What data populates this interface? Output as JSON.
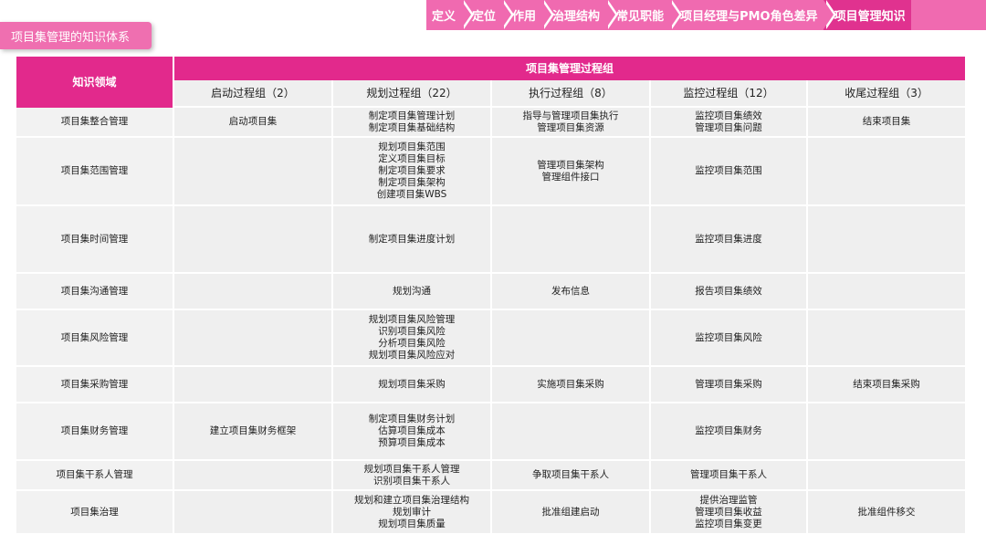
{
  "nav": {
    "items": [
      "定义",
      "定位",
      "作用",
      "治理结构",
      "常见职能",
      "项目经理与PMO角色差异",
      "项目管理知识"
    ],
    "active_index": 6
  },
  "page_title": "项目集管理的知识体系",
  "table": {
    "domain_header": "知识领域",
    "group_header": "项目集管理过程组",
    "columns": [
      "启动过程组（2）",
      "规划过程组（22）",
      "执行过程组（8）",
      "监控过程组（12）",
      "收尾过程组（3）"
    ],
    "rows": [
      {
        "domain": "项目集整合管理",
        "cells": [
          [
            "启动项目集"
          ],
          [
            "制定项目集管理计划",
            "制定项目集基础结构"
          ],
          [
            "指导与管理项目集执行",
            "管理项目集资源"
          ],
          [
            "监控项目集绩效",
            "管理项目集问题"
          ],
          [
            "结束项目集"
          ]
        ]
      },
      {
        "domain": "项目集范围管理",
        "cells": [
          [],
          [
            "规划项目集范围",
            "定义项目集目标",
            "制定项目集要求",
            "制定项目集架构",
            "创建项目集WBS"
          ],
          [
            "管理项目集架构",
            "管理组件接口"
          ],
          [
            "监控项目集范围"
          ],
          []
        ]
      },
      {
        "domain": "项目集时间管理",
        "cells": [
          [],
          [
            "制定项目集进度计划"
          ],
          [],
          [
            "监控项目集进度"
          ],
          []
        ]
      },
      {
        "domain": "项目集沟通管理",
        "cells": [
          [],
          [
            "规划沟通"
          ],
          [
            "发布信息"
          ],
          [
            "报告项目集绩效"
          ],
          []
        ]
      },
      {
        "domain": "项目集风险管理",
        "cells": [
          [],
          [
            "规划项目集风险管理",
            "识别项目集风险",
            "分析项目集风险",
            "规划项目集风险应对"
          ],
          [],
          [
            "监控项目集风险"
          ],
          []
        ]
      },
      {
        "domain": "项目集采购管理",
        "cells": [
          [],
          [
            "规划项目集采购"
          ],
          [
            "实施项目集采购"
          ],
          [
            "管理项目集采购"
          ],
          [
            "结束项目集采购"
          ]
        ]
      },
      {
        "domain": "项目集财务管理",
        "cells": [
          [
            "建立项目集财务框架"
          ],
          [
            "制定项目集财务计划",
            "估算项目集成本",
            "预算项目集成本"
          ],
          [],
          [
            "监控项目集财务"
          ],
          []
        ]
      },
      {
        "domain": "项目集干系人管理",
        "cells": [
          [],
          [
            "规划项目集干系人管理",
            "识别项目集干系人"
          ],
          [
            "争取项目集干系人"
          ],
          [
            "管理项目集干系人"
          ],
          []
        ]
      },
      {
        "domain": "项目集治理",
        "cells": [
          [],
          [
            "规划和建立项目集治理结构",
            "规划审计",
            "规划项目集质量"
          ],
          [
            "批准组建启动"
          ],
          [
            "提供治理监管",
            "管理项目集收益",
            "监控项目集变更"
          ],
          [
            "批准组件移交"
          ]
        ]
      }
    ]
  }
}
